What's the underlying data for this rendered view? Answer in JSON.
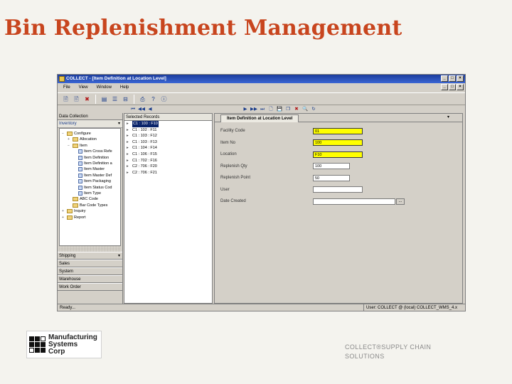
{
  "slide": {
    "title": "Bin Replenishment Management",
    "footer": "COLLECT®SUPPLY CHAIN SOLUTIONS",
    "logo": {
      "lines": [
        "Manufacturing",
        "Systems",
        "Corp"
      ]
    }
  },
  "app": {
    "title": "COLLECT - [Item Definition at Location Level]",
    "window_controls": [
      "_",
      "□",
      "×"
    ],
    "mdi_controls": [
      "_",
      "□",
      "×"
    ],
    "menu": [
      "File",
      "View",
      "Window",
      "Help"
    ]
  },
  "toolbar": {
    "icons": [
      "new-icon",
      "open-icon",
      "delete-icon",
      "properties-icon",
      "list-icon",
      "filter-icon",
      "print-icon",
      "help-icon",
      "info-icon"
    ],
    "glyphs": [
      "🗎",
      "🖹",
      "✖",
      "▤",
      "☰",
      "⊟",
      "⎙",
      "?",
      "ⓘ"
    ]
  },
  "nav_bar": {
    "icons": [
      "first-icon",
      "prev-fast-icon",
      "prev-icon",
      "next-icon",
      "next-fast-icon",
      "last-icon",
      "new-record-icon",
      "save-icon",
      "copy-icon",
      "delete-record-icon",
      "search-icon",
      "refresh-icon"
    ],
    "glyphs": [
      "⏮",
      "◀◀",
      "◀",
      "▶",
      "▶▶",
      "⏭",
      "🗋",
      "💾",
      "❐",
      "✖",
      "🔍",
      "↻"
    ]
  },
  "left_panel": {
    "data_collection": "Data Collection",
    "inventory": "Inventory",
    "tree": [
      {
        "label": "Configure",
        "level": 0,
        "kind": "folder",
        "exp": "−"
      },
      {
        "label": "Allocation",
        "level": 1,
        "kind": "folder",
        "exp": "+"
      },
      {
        "label": "Item",
        "level": 1,
        "kind": "folder",
        "exp": "−"
      },
      {
        "label": "Item Cross Refe",
        "level": 2,
        "kind": "leaf",
        "exp": ""
      },
      {
        "label": "Item Definition",
        "level": 2,
        "kind": "leaf",
        "exp": ""
      },
      {
        "label": "Item Definition a",
        "level": 2,
        "kind": "leaf",
        "exp": ""
      },
      {
        "label": "Item Master",
        "level": 2,
        "kind": "leaf",
        "exp": ""
      },
      {
        "label": "Item Master Def",
        "level": 2,
        "kind": "leaf",
        "exp": ""
      },
      {
        "label": "Item Packaging",
        "level": 2,
        "kind": "leaf",
        "exp": ""
      },
      {
        "label": "Item Status Cod",
        "level": 2,
        "kind": "leaf",
        "exp": ""
      },
      {
        "label": "Item Type",
        "level": 2,
        "kind": "leaf",
        "exp": ""
      },
      {
        "label": "ABC Code",
        "level": 1,
        "kind": "folder",
        "exp": ""
      },
      {
        "label": "Bar Code Types",
        "level": 1,
        "kind": "folder",
        "exp": ""
      },
      {
        "label": "Inquiry",
        "level": 0,
        "kind": "folder",
        "exp": "+"
      },
      {
        "label": "Report",
        "level": 0,
        "kind": "folder",
        "exp": "+"
      }
    ],
    "buttons": [
      "Shipping",
      "Sales",
      "System",
      "Warehouse",
      "Work Order"
    ]
  },
  "mid_panel": {
    "header": "Selected Records",
    "records": [
      "C1 : 100 : F10",
      "C1 : 102 : F11",
      "C1 : 103 : F12",
      "C1 : 103 : F13",
      "C1 : 104 : F14",
      "C1 : 106 : F15",
      "C1 : 702 : F16",
      "C2 : 706 : F20",
      "C2 : 706 : F21"
    ]
  },
  "form": {
    "tab": "Item Definition at Location Level",
    "fields": [
      {
        "label": "Facility Code",
        "value": "01",
        "style": "yellow"
      },
      {
        "label": "Item No",
        "value": "100",
        "style": "yellow"
      },
      {
        "label": "Location",
        "value": "F10",
        "style": "yellow"
      },
      {
        "label": "Replenish Qty",
        "value": "100",
        "style": "white"
      },
      {
        "label": "Replenish Point",
        "value": "50",
        "style": "white"
      },
      {
        "label": "User",
        "value": "",
        "style": "white"
      },
      {
        "label": "Date Created",
        "value": "",
        "style": "white"
      }
    ],
    "ellipsis": "..."
  },
  "status": {
    "left": "Ready...",
    "right": "User: COLLECT @ (local) COLLECT_WMS_4.x"
  }
}
